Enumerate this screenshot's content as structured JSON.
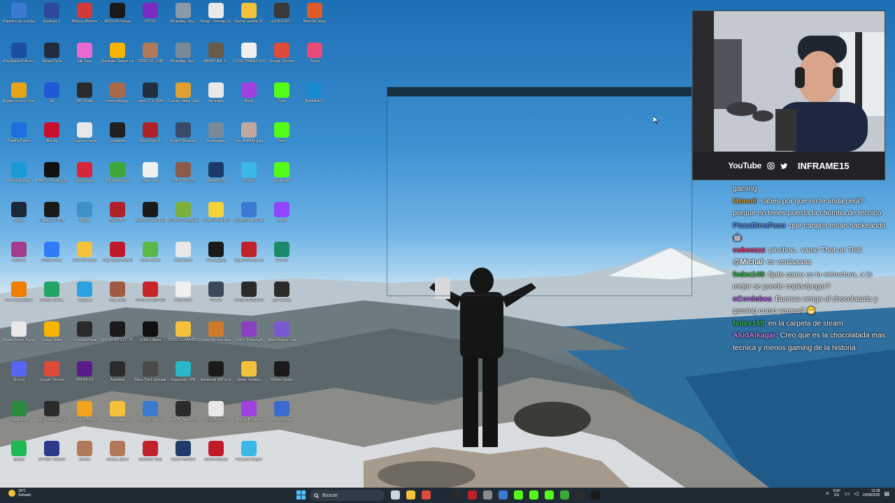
{
  "desktop": {
    "columns": [
      [
        {
          "label": "Papelera de reciclaje",
          "icon": "recycle-bin-icon",
          "color": "#3a7ad0"
        },
        {
          "label": "PlayStation® Accessories",
          "icon": "playstation-icon",
          "color": "#1b4fa0"
        },
        {
          "label": "Elgato Control Center",
          "icon": "elgato-icon",
          "color": "#e8a418"
        },
        {
          "label": "Trading Paints",
          "icon": "trading-paints-icon",
          "color": "#1e6fe0"
        },
        {
          "label": "Microsoft Edge",
          "icon": "edge-icon",
          "color": "#1a9bd8"
        },
        {
          "label": "Steam",
          "icon": "steam-icon",
          "color": "#1b2838"
        },
        {
          "label": "WinRAR",
          "icon": "winrar-icon",
          "color": "#a33d8a"
        },
        {
          "label": "VLC media player",
          "icon": "vlc-icon",
          "color": "#f07d00"
        },
        {
          "label": "Media Player Classic",
          "icon": "media-player-icon",
          "color": "#e8e8e8"
        },
        {
          "label": "Discord",
          "icon": "discord-icon",
          "color": "#5865f2"
        },
        {
          "label": "Google Earth",
          "icon": "google-earth-icon",
          "color": "#2b8a3e"
        },
        {
          "label": "Spotify",
          "icon": "spotify-icon",
          "color": "#1db954"
        }
      ],
      [
        {
          "label": "KeePass 2",
          "icon": "keepass-icon",
          "color": "#2d4a9a"
        },
        {
          "label": "Stream Deck",
          "icon": "stream-deck-icon",
          "color": "#222a40"
        },
        {
          "label": "EA",
          "icon": "ea-icon",
          "color": "#1e5ad8"
        },
        {
          "label": "iRacing",
          "icon": "iracing-icon",
          "color": "#c8102e"
        },
        {
          "label": "PBA Pro Bowling 2023 Demo",
          "icon": "pba-icon",
          "color": "#101010"
        },
        {
          "label": "Logitech G HUB",
          "icon": "logitech-icon",
          "color": "#1a1a1a"
        },
        {
          "label": "Google Docs",
          "icon": "google-docs-icon",
          "color": "#2f7cf6"
        },
        {
          "label": "Google Sheets",
          "icon": "google-sheets-icon",
          "color": "#21a464"
        },
        {
          "label": "Google Slides",
          "icon": "google-slides-icon",
          "color": "#f4b400"
        },
        {
          "label": "Google Chrome",
          "icon": "chrome-icon",
          "color": "#dd4b39"
        },
        {
          "label": "Epic Games Launcher",
          "icon": "epic-icon",
          "color": "#2a2a2a"
        },
        {
          "label": "OFFSET Discord",
          "icon": "offset-icon",
          "color": "#2d3a8c"
        }
      ],
      [
        {
          "label": "Bitfocus Buttons",
          "icon": "bitfocus-icon",
          "color": "#d23a3a"
        },
        {
          "label": "Fall Guys",
          "icon": "fall-guys-icon",
          "color": "#e86ad0"
        },
        {
          "label": "OBS Studio",
          "icon": "obs-icon",
          "color": "#2b2b2b"
        },
        {
          "label": "Coaches Game",
          "icon": "coaches-icon",
          "color": "#e8e8e8"
        },
        {
          "label": "RaceRoom",
          "icon": "raceroom-icon",
          "color": "#d8253a"
        },
        {
          "label": "Rappa",
          "icon": "rappa-icon",
          "color": "#3f8fc9"
        },
        {
          "label": "El bar de rappa",
          "icon": "folder-icon",
          "color": "#f3c13a"
        },
        {
          "label": "Telegram",
          "icon": "telegram-icon",
          "color": "#2aa3e0"
        },
        {
          "label": "Crossout Break",
          "icon": "crossout-icon",
          "color": "#2a2a2a"
        },
        {
          "label": "OPERA GX",
          "icon": "opera-gx-icon",
          "color": "#5a1c8a"
        },
        {
          "label": "Uniquet Bricks",
          "icon": "bricks-icon",
          "color": "#f3a21c"
        },
        {
          "label": "sinistro",
          "icon": "person-icon",
          "color": "#b07a5a"
        }
      ],
      [
        {
          "label": "MOZA Pit House",
          "icon": "moza-icon",
          "color": "#1a1a1a"
        },
        {
          "label": "Rockstar Games Launcher",
          "icon": "rockstar-icon",
          "color": "#f4b400"
        },
        {
          "label": "minecraft.jpeg",
          "icon": "person-icon",
          "color": "#a86a48"
        },
        {
          "label": "Companion",
          "icon": "companion-icon",
          "color": "#202020"
        },
        {
          "label": "MSI Afterburner",
          "icon": "msi-icon",
          "color": "#3fa63a"
        },
        {
          "label": "CarX/OPE",
          "icon": "carx-icon",
          "color": "#b0222a"
        },
        {
          "label": "Cars Racing Simulator",
          "icon": "cars-icon",
          "color": "#c01a2a"
        },
        {
          "label": "regn_thing",
          "icon": "person-icon",
          "color": "#a05a42"
        },
        {
          "label": "EA SPORTS FC 25",
          "icon": "ea-fc-icon",
          "color": "#1a1a1a"
        },
        {
          "label": "Autodesk",
          "icon": "autodesk-icon",
          "color": "#2b2b2b"
        },
        {
          "label": "Nueva carpeta",
          "icon": "folder-icon",
          "color": "#f3c13a"
        },
        {
          "label": "mosaic_tryout",
          "icon": "person-icon",
          "color": "#b07a5a"
        }
      ],
      [
        {
          "label": "FPCS2",
          "icon": "fpcs-icon",
          "color": "#7a2bc0"
        },
        {
          "label": "20230716_2148",
          "icon": "person-icon",
          "color": "#b07a5a"
        },
        {
          "label": "carpt_6_1x1584",
          "icon": "car-icon",
          "color": "#203040"
        },
        {
          "label": "RaceRoom 2",
          "icon": "r2-icon",
          "color": "#b0222a"
        },
        {
          "label": "Dolar Flow",
          "icon": "document-icon",
          "color": "#f0f0f0"
        },
        {
          "label": "Assetto Corsa Rally",
          "icon": "acr-icon",
          "color": "#1a1a1a"
        },
        {
          "label": "Sonic Studio",
          "icon": "sonic-icon",
          "color": "#5ab84a"
        },
        {
          "label": "TOTAL DE EMPRESAS",
          "icon": "building-icon",
          "color": "#c8252a"
        },
        {
          "label": "GOALS Alpha",
          "icon": "goals-icon",
          "color": "#101010"
        },
        {
          "label": "Race Track Simulator",
          "icon": "race-track-icon",
          "color": "#4a4a4a"
        },
        {
          "label": "Rocket League",
          "icon": "rocket-icon",
          "color": "#3a7ad0"
        },
        {
          "label": "Streamer Tools",
          "icon": "tools-icon",
          "color": "#c0222a"
        }
      ],
      [
        {
          "label": "WhatsApp_Ima...",
          "icon": "image-icon",
          "color": "#8a9aa8"
        },
        {
          "label": "WhatsApp_Ima...",
          "icon": "image-icon",
          "color": "#7a8a98"
        },
        {
          "label": "Counter-Strike Global Offensive",
          "icon": "csgo-icon",
          "color": "#e0a030"
        },
        {
          "label": "HyperX NGenuity",
          "icon": "hyperx-icon",
          "color": "#3a4a6a"
        },
        {
          "label": "GTA V DOS (2)",
          "icon": "person-icon",
          "color": "#8a5a4a"
        },
        {
          "label": "SimHub Configuration",
          "icon": "simhub-icon",
          "color": "#7ab03a"
        },
        {
          "label": "Screenshot",
          "icon": "screenshot-icon",
          "color": "#e8e8e8"
        },
        {
          "label": "Dolar 2024",
          "icon": "document-icon",
          "color": "#f0f0f0"
        },
        {
          "label": "VODS LLUVIA PESADA",
          "icon": "folder-icon",
          "color": "#f3c13a"
        },
        {
          "label": "Kaspersky VPN",
          "icon": "vpn-icon",
          "color": "#2ab8c8"
        },
        {
          "label": "Need for Speed Unbound",
          "icon": "nfs-icon",
          "color": "#2b2b2b"
        },
        {
          "label": "Steam Runtime",
          "icon": "steam-icon",
          "color": "#203a6a"
        }
      ],
      [
        {
          "label": "Nmap - Zenmap GUI",
          "icon": "nmap-icon",
          "color": "#e8e8e8"
        },
        {
          "label": "MINIATURA_F...",
          "icon": "image-icon",
          "color": "#6a5a4a"
        },
        {
          "label": "Moonlight",
          "icon": "moonlight-icon",
          "color": "#e8e8e8"
        },
        {
          "label": "Rectbagging",
          "icon": "rectbag-icon",
          "color": "#7a8a98"
        },
        {
          "label": "REMATCH",
          "icon": "rematch-icon",
          "color": "#1a3a6a"
        },
        {
          "label": "LessFrs Grading",
          "icon": "duck-icon",
          "color": "#f3d23a"
        },
        {
          "label": "Rectbagging",
          "icon": "rectbag-icon",
          "color": "#1a1a1a"
        },
        {
          "label": "FIFA 24",
          "icon": "fifa-icon",
          "color": "#3a4a5a"
        },
        {
          "label": "Twitch Acceso directo",
          "icon": "twitch-shortcut-icon",
          "color": "#d07a2a"
        },
        {
          "label": "Advanced BAT to EXE Converter",
          "icon": "bat-icon",
          "color": "#1a1a1a"
        },
        {
          "label": "Forza Horizon 5",
          "icon": "forza-icon",
          "color": "#e8e8e8"
        },
        {
          "label": "ASUS Armoury",
          "icon": "armoury-icon",
          "color": "#c01a2a"
        }
      ],
      [
        {
          "label": "Nueva carpeta (2)",
          "icon": "folder-icon",
          "color": "#f3c13a"
        },
        {
          "label": "LISTA TORNEO FORD/ECO...",
          "icon": "document-icon",
          "color": "#f0f0f0"
        },
        {
          "label": "Moofy",
          "icon": "moofy-icon",
          "color": "#a040e0"
        },
        {
          "label": "toxic ANIMAL.jpeg",
          "icon": "image-icon",
          "color": "#c0a8a0"
        },
        {
          "label": "Pointeo",
          "icon": "pointeo-icon",
          "color": "#3ab8e8"
        },
        {
          "label": "SoundSpeak 3 Client",
          "icon": "soundspeak-icon",
          "color": "#3a7ad0"
        },
        {
          "label": "SuperMeat Boy 3D",
          "icon": "meatboy-icon",
          "color": "#c0222a"
        },
        {
          "label": "MOBA DUNGEON",
          "icon": "moba-icon",
          "color": "#2a2a2a"
        },
        {
          "label": "Video_Project.pif",
          "icon": "video-icon",
          "color": "#8a40c0"
        },
        {
          "label": "Steam Updates",
          "icon": "folder-icon",
          "color": "#f3c13a"
        },
        {
          "label": "Microsoft Copilot",
          "icon": "copilot-icon",
          "color": "#a040e0"
        },
        {
          "label": "FeelLove Rapper",
          "icon": "rapper-icon",
          "color": "#3ab8e8"
        }
      ],
      [
        {
          "label": "ac37fc0-021...",
          "icon": "person-icon",
          "color": "#3a3a3a"
        },
        {
          "label": "Google Chrome",
          "icon": "chrome-icon",
          "color": "#dd4b39"
        },
        {
          "label": "Chat",
          "icon": "kick-icon",
          "color": "#53fc18"
        },
        {
          "label": "Feed",
          "icon": "kick-icon",
          "color": "#53fc18"
        },
        {
          "label": "Dashboard",
          "icon": "kick-icon",
          "color": "#53fc18"
        },
        {
          "label": "Twitch",
          "icon": "twitch-icon",
          "color": "#9146ff"
        },
        {
          "label": "FIFA 16",
          "icon": "fifa16-icon",
          "color": "#1a8a6a"
        },
        {
          "label": "BG Gaming",
          "icon": "bg-icon",
          "color": "#2a2a2a"
        },
        {
          "label": "Meta Horizon Link",
          "icon": "meta-icon",
          "color": "#7a5ad0"
        },
        {
          "label": "Roblox Studio",
          "icon": "roblox-icon",
          "color": "#1a1a1a"
        },
        {
          "label": "Roblox Player",
          "icon": "roblox-player-icon",
          "color": "#3a6ad0"
        },
        {
          "label": "",
          "icon": "",
          "color": ""
        }
      ],
      [
        {
          "label": "BeamNG.drive",
          "icon": "beamng-icon",
          "color": "#e05a2a"
        },
        {
          "label": "iTunes",
          "icon": "itunes-icon",
          "color": "#e84a7a"
        },
        {
          "label": "Battlefield 6",
          "icon": "battlefield-icon",
          "color": "#1a8ad0"
        },
        {
          "label": "",
          "icon": "",
          "color": ""
        },
        {
          "label": "",
          "icon": "",
          "color": ""
        },
        {
          "label": "",
          "icon": "",
          "color": ""
        },
        {
          "label": "",
          "icon": "",
          "color": ""
        },
        {
          "label": "",
          "icon": "",
          "color": ""
        },
        {
          "label": "",
          "icon": "",
          "color": ""
        },
        {
          "label": "",
          "icon": "",
          "color": ""
        },
        {
          "label": "",
          "icon": "",
          "color": ""
        },
        {
          "label": "",
          "icon": "",
          "color": ""
        }
      ]
    ]
  },
  "webcam": {
    "youtube_label": "YouTube",
    "instagram_icon": "instagram-icon",
    "twitter_icon": "twitter-icon",
    "handle": "INFRAME15"
  },
  "chat": {
    "messages": [
      {
        "user": "",
        "user_color": "#ffffff",
        "text": "gaming"
      },
      {
        "user": "Mono8",
        "user_color": "#d9a441",
        "text": ": sabes por que no te anda pelá? porque no tenes puesta la chomba de tecnico"
      },
      {
        "user": "PizzaBirraFaso",
        "user_color": "#5b8fe8",
        "text": ": que carajos estan hackeando 🤖"
      },
      {
        "user": "cubeezzz",
        "user_color": "#e8407a",
        "text": ": pinchoo.. vamo Thot on Trial"
      },
      {
        "user": "@Michal",
        "user_color": "#ffffff",
        "text": ": es verdaaaaa"
      },
      {
        "user": "fedex149",
        "user_color": "#3ab858",
        "text": ": fijate como es la estructura, a lo mejor se puede copiar/pegar?"
      },
      {
        "user": "nCordobes",
        "user_color": "#b060e8",
        "text": ": Buenas vengo al chocolatada y gaming como vamos? 😁"
      },
      {
        "user": "fedex149",
        "user_color": "#3ab858",
        "text": ": en la carpeta de steam"
      },
      {
        "user": "AludAlkagar",
        "user_color": "#c084f0",
        "text": ": Creo que es la chocolatada mas tecnica y menos gaming de la historia"
      }
    ]
  },
  "taskbar": {
    "weather_temp": "18°C",
    "weather_desc": "Soleado",
    "search_placeholder": "Buscar",
    "lang_top": "ESP",
    "lang_bottom": "ES",
    "time": "13:38",
    "date": "19/08/2026",
    "apps": [
      {
        "icon": "task-view-icon",
        "color": "#cfd6de"
      },
      {
        "icon": "file-explorer-icon",
        "color": "#f3c13a"
      },
      {
        "icon": "chrome-icon",
        "color": "#dd4b39"
      },
      {
        "icon": "steam-icon",
        "color": "#1b2838"
      },
      {
        "icon": "obs-icon",
        "color": "#2b2b2b"
      },
      {
        "icon": "app-icon",
        "color": "#c0222a"
      },
      {
        "icon": "app-icon",
        "color": "#8a8a8a"
      },
      {
        "icon": "app-icon",
        "color": "#3a7ad0"
      },
      {
        "icon": "kick-icon",
        "color": "#53fc18"
      },
      {
        "icon": "kick-icon",
        "color": "#53fc18"
      },
      {
        "icon": "kick-icon",
        "color": "#53fc18"
      },
      {
        "icon": "xbox-icon",
        "color": "#3aa83a"
      },
      {
        "icon": "terminal-icon",
        "color": "#2b2b2b"
      },
      {
        "icon": "app-icon",
        "color": "#1a1a1a"
      }
    ]
  }
}
